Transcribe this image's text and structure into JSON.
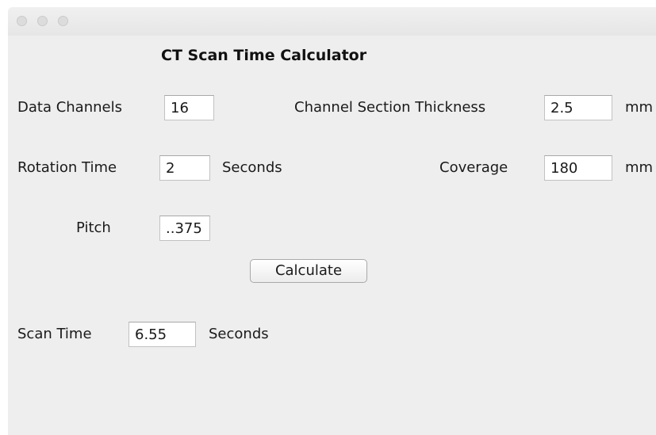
{
  "window": {
    "title": "",
    "controls": [
      "close-button",
      "minimize-button",
      "zoom-button"
    ]
  },
  "form": {
    "title": "CT Scan Time Calculator",
    "data_channels": {
      "label": "Data Channels",
      "value": "16"
    },
    "channel_section_thickness": {
      "label": "Channel Section Thickness",
      "value": "2.5",
      "unit": "mm"
    },
    "rotation_time": {
      "label": "Rotation Time",
      "value": "2",
      "unit": "Seconds"
    },
    "coverage": {
      "label": "Coverage",
      "value": "180",
      "unit": "mm"
    },
    "pitch": {
      "label": "Pitch",
      "value": "..375"
    },
    "calculate_label": "Calculate",
    "scan_time": {
      "label": "Scan Time",
      "value": "6.55",
      "unit": "Seconds"
    }
  }
}
